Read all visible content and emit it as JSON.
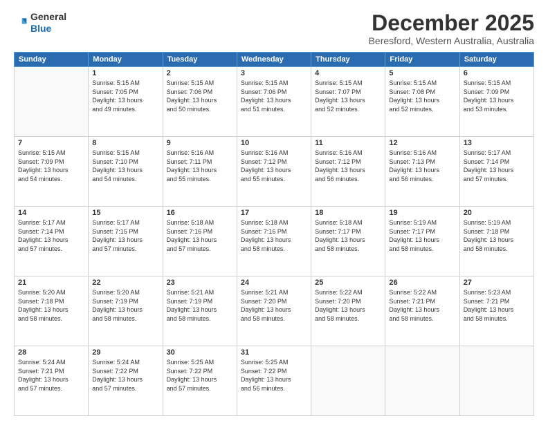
{
  "logo": {
    "general": "General",
    "blue": "Blue"
  },
  "header": {
    "month": "December 2025",
    "location": "Beresford, Western Australia, Australia"
  },
  "weekdays": [
    "Sunday",
    "Monday",
    "Tuesday",
    "Wednesday",
    "Thursday",
    "Friday",
    "Saturday"
  ],
  "weeks": [
    [
      {
        "day": "",
        "info": ""
      },
      {
        "day": "1",
        "info": "Sunrise: 5:15 AM\nSunset: 7:05 PM\nDaylight: 13 hours\nand 49 minutes."
      },
      {
        "day": "2",
        "info": "Sunrise: 5:15 AM\nSunset: 7:06 PM\nDaylight: 13 hours\nand 50 minutes."
      },
      {
        "day": "3",
        "info": "Sunrise: 5:15 AM\nSunset: 7:06 PM\nDaylight: 13 hours\nand 51 minutes."
      },
      {
        "day": "4",
        "info": "Sunrise: 5:15 AM\nSunset: 7:07 PM\nDaylight: 13 hours\nand 52 minutes."
      },
      {
        "day": "5",
        "info": "Sunrise: 5:15 AM\nSunset: 7:08 PM\nDaylight: 13 hours\nand 52 minutes."
      },
      {
        "day": "6",
        "info": "Sunrise: 5:15 AM\nSunset: 7:09 PM\nDaylight: 13 hours\nand 53 minutes."
      }
    ],
    [
      {
        "day": "7",
        "info": "Sunrise: 5:15 AM\nSunset: 7:09 PM\nDaylight: 13 hours\nand 54 minutes."
      },
      {
        "day": "8",
        "info": "Sunrise: 5:15 AM\nSunset: 7:10 PM\nDaylight: 13 hours\nand 54 minutes."
      },
      {
        "day": "9",
        "info": "Sunrise: 5:16 AM\nSunset: 7:11 PM\nDaylight: 13 hours\nand 55 minutes."
      },
      {
        "day": "10",
        "info": "Sunrise: 5:16 AM\nSunset: 7:12 PM\nDaylight: 13 hours\nand 55 minutes."
      },
      {
        "day": "11",
        "info": "Sunrise: 5:16 AM\nSunset: 7:12 PM\nDaylight: 13 hours\nand 56 minutes."
      },
      {
        "day": "12",
        "info": "Sunrise: 5:16 AM\nSunset: 7:13 PM\nDaylight: 13 hours\nand 56 minutes."
      },
      {
        "day": "13",
        "info": "Sunrise: 5:17 AM\nSunset: 7:14 PM\nDaylight: 13 hours\nand 57 minutes."
      }
    ],
    [
      {
        "day": "14",
        "info": "Sunrise: 5:17 AM\nSunset: 7:14 PM\nDaylight: 13 hours\nand 57 minutes."
      },
      {
        "day": "15",
        "info": "Sunrise: 5:17 AM\nSunset: 7:15 PM\nDaylight: 13 hours\nand 57 minutes."
      },
      {
        "day": "16",
        "info": "Sunrise: 5:18 AM\nSunset: 7:16 PM\nDaylight: 13 hours\nand 57 minutes."
      },
      {
        "day": "17",
        "info": "Sunrise: 5:18 AM\nSunset: 7:16 PM\nDaylight: 13 hours\nand 58 minutes."
      },
      {
        "day": "18",
        "info": "Sunrise: 5:18 AM\nSunset: 7:17 PM\nDaylight: 13 hours\nand 58 minutes."
      },
      {
        "day": "19",
        "info": "Sunrise: 5:19 AM\nSunset: 7:17 PM\nDaylight: 13 hours\nand 58 minutes."
      },
      {
        "day": "20",
        "info": "Sunrise: 5:19 AM\nSunset: 7:18 PM\nDaylight: 13 hours\nand 58 minutes."
      }
    ],
    [
      {
        "day": "21",
        "info": "Sunrise: 5:20 AM\nSunset: 7:18 PM\nDaylight: 13 hours\nand 58 minutes."
      },
      {
        "day": "22",
        "info": "Sunrise: 5:20 AM\nSunset: 7:19 PM\nDaylight: 13 hours\nand 58 minutes."
      },
      {
        "day": "23",
        "info": "Sunrise: 5:21 AM\nSunset: 7:19 PM\nDaylight: 13 hours\nand 58 minutes."
      },
      {
        "day": "24",
        "info": "Sunrise: 5:21 AM\nSunset: 7:20 PM\nDaylight: 13 hours\nand 58 minutes."
      },
      {
        "day": "25",
        "info": "Sunrise: 5:22 AM\nSunset: 7:20 PM\nDaylight: 13 hours\nand 58 minutes."
      },
      {
        "day": "26",
        "info": "Sunrise: 5:22 AM\nSunset: 7:21 PM\nDaylight: 13 hours\nand 58 minutes."
      },
      {
        "day": "27",
        "info": "Sunrise: 5:23 AM\nSunset: 7:21 PM\nDaylight: 13 hours\nand 58 minutes."
      }
    ],
    [
      {
        "day": "28",
        "info": "Sunrise: 5:24 AM\nSunset: 7:21 PM\nDaylight: 13 hours\nand 57 minutes."
      },
      {
        "day": "29",
        "info": "Sunrise: 5:24 AM\nSunset: 7:22 PM\nDaylight: 13 hours\nand 57 minutes."
      },
      {
        "day": "30",
        "info": "Sunrise: 5:25 AM\nSunset: 7:22 PM\nDaylight: 13 hours\nand 57 minutes."
      },
      {
        "day": "31",
        "info": "Sunrise: 5:25 AM\nSunset: 7:22 PM\nDaylight: 13 hours\nand 56 minutes."
      },
      {
        "day": "",
        "info": ""
      },
      {
        "day": "",
        "info": ""
      },
      {
        "day": "",
        "info": ""
      }
    ]
  ]
}
